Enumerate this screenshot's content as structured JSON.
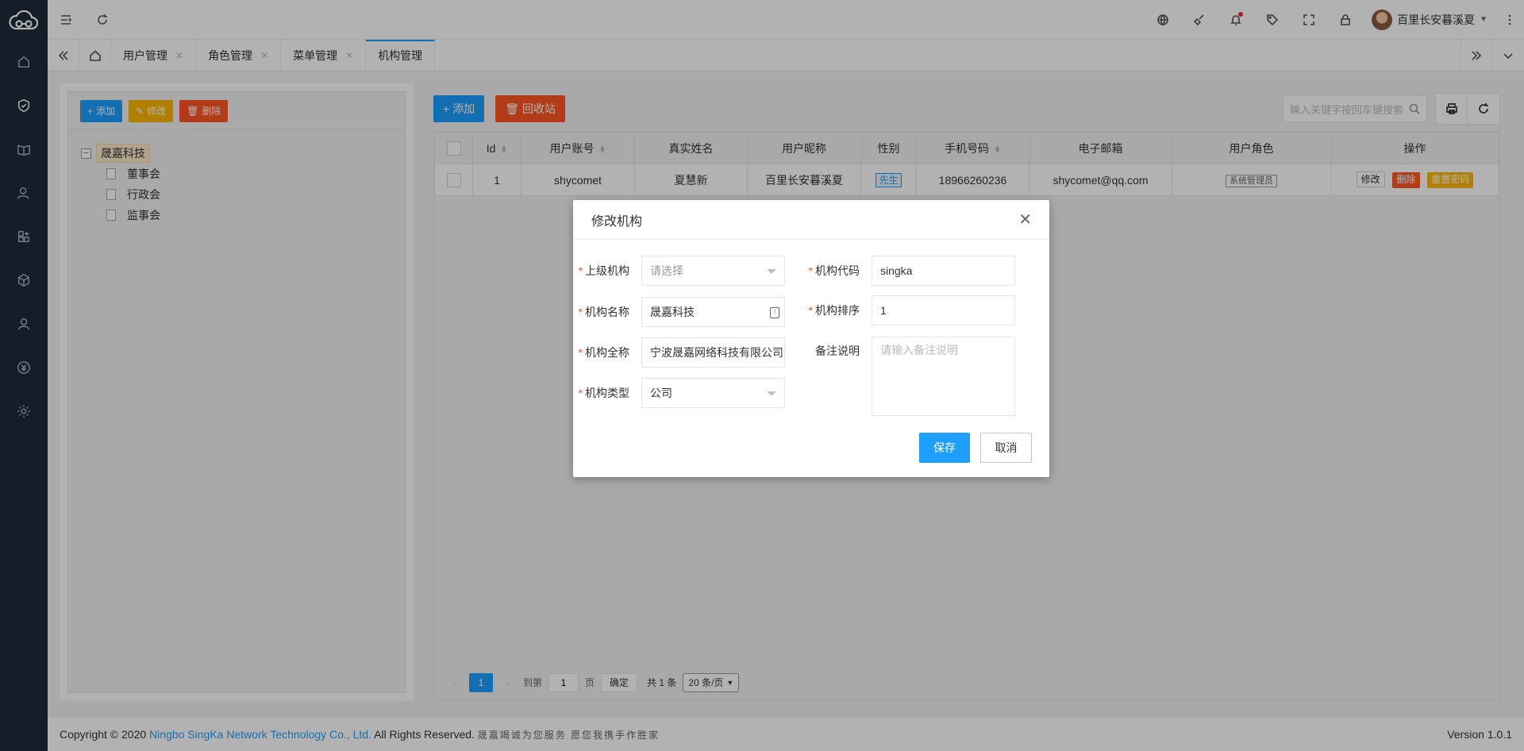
{
  "header": {
    "user_name": "百里长安暮溪夏"
  },
  "tabs": [
    {
      "label": "用户管理"
    },
    {
      "label": "角色管理"
    },
    {
      "label": "菜单管理"
    },
    {
      "label": "机构管理"
    }
  ],
  "left_panel": {
    "buttons": {
      "add": "添加",
      "edit": "修改",
      "delete": "删除"
    },
    "tree": {
      "root": "晟嘉科技",
      "children": [
        "董事会",
        "行政会",
        "监事会"
      ]
    }
  },
  "right_panel": {
    "buttons": {
      "add": "添加",
      "recycle": "回收站"
    },
    "search": {
      "placeholder": "输入关键字按回车键搜索"
    },
    "table": {
      "headers": [
        "Id",
        "用户账号",
        "真实姓名",
        "用户昵称",
        "性别",
        "手机号码",
        "电子邮箱",
        "用户角色",
        "操作"
      ],
      "rows": [
        {
          "id": "1",
          "account": "shycomet",
          "real_name": "夏慧新",
          "nickname": "百里长安暮溪夏",
          "gender": "先生",
          "phone": "18966260236",
          "email": "shycomet@qq.com",
          "role": "系统管理员",
          "actions": {
            "edit": "修改",
            "delete": "删除",
            "reset": "重置密码"
          }
        }
      ]
    },
    "pager": {
      "current": "1",
      "goto_label": "到第",
      "goto_value": "1",
      "page_unit": "页",
      "confirm": "确定",
      "total": "共 1 条",
      "page_size": "20 条/页"
    }
  },
  "footer": {
    "copyright_prefix": "Copyright © 2020",
    "company": "Ningbo SingKa Network Technology Co., Ltd.",
    "rights": "All Rights Reserved.",
    "slogan": "晟嘉竭诚为您服务 愿您我携手作胜家",
    "version": "Version 1.0.1"
  },
  "modal": {
    "title": "修改机构",
    "fields": {
      "parent": {
        "label": "上级机构",
        "placeholder": "请选择"
      },
      "code": {
        "label": "机构代码",
        "value": "singka"
      },
      "name": {
        "label": "机构名称",
        "value": "晟嘉科技"
      },
      "sort": {
        "label": "机构排序",
        "value": "1"
      },
      "full_name": {
        "label": "机构全称",
        "value": "宁波晟嘉网络科技有限公司"
      },
      "remark": {
        "label": "备注说明",
        "placeholder": "请输入备注说明"
      },
      "type": {
        "label": "机构类型",
        "value": "公司"
      }
    },
    "save": "保存",
    "cancel": "取消"
  },
  "colors": {
    "primary": "#1e9fff",
    "warning": "#ffb800",
    "danger": "#ff5722",
    "sidebar": "#1d2b3a"
  }
}
